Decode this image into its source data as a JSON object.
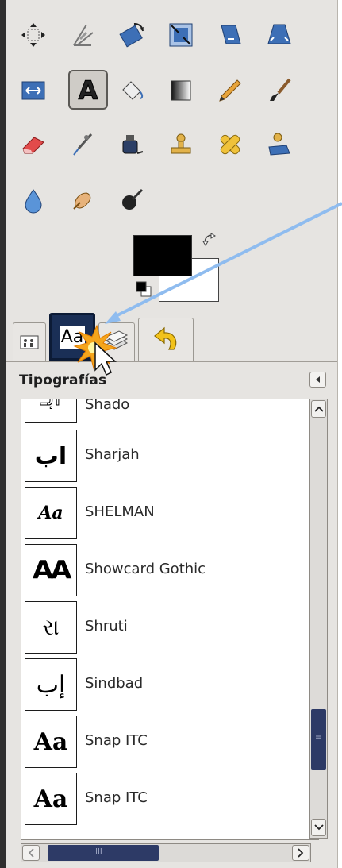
{
  "colors": {
    "panel_bg": "#e6e4e1",
    "selected_tab": "#1a2f56",
    "scroll_thumb": "#2d3a66",
    "annotation_arrow": "#8fbcef",
    "foreground_color": "#000000",
    "background_color": "#ffffff"
  },
  "toolbox": {
    "tools": [
      {
        "name": "move-tool-icon"
      },
      {
        "name": "crop-tool-icon"
      },
      {
        "name": "rotate-tool-icon"
      },
      {
        "name": "scale-tool-icon"
      },
      {
        "name": "shear-tool-icon"
      },
      {
        "name": "perspective-tool-icon"
      },
      {
        "name": "flip-tool-icon"
      },
      {
        "name": "text-tool-icon",
        "label": "A",
        "active": true
      },
      {
        "name": "bucket-fill-tool-icon"
      },
      {
        "name": "blend-tool-icon"
      },
      {
        "name": "pencil-tool-icon"
      },
      {
        "name": "paintbrush-tool-icon"
      },
      {
        "name": "eraser-tool-icon"
      },
      {
        "name": "airbrush-tool-icon"
      },
      {
        "name": "ink-tool-icon"
      },
      {
        "name": "clone-tool-icon"
      },
      {
        "name": "heal-tool-icon"
      },
      {
        "name": "perspective-clone-tool-icon"
      },
      {
        "name": "blur-sharpen-tool-icon"
      },
      {
        "name": "smudge-tool-icon"
      },
      {
        "name": "dodge-burn-tool-icon"
      }
    ]
  },
  "tabs": {
    "items": [
      {
        "name": "tab-tool-options",
        "icon": "tool-options-icon"
      },
      {
        "name": "tab-fonts",
        "label": "Aa",
        "selected": true
      },
      {
        "name": "tab-layers",
        "icon": "layers-icon"
      },
      {
        "name": "tab-undo-history",
        "icon": "undo-icon"
      }
    ]
  },
  "dock": {
    "title": "Tipografías",
    "config_icon": "triangle-left-icon"
  },
  "fonts": [
    {
      "name": "Shado",
      "preview": "ابـ",
      "style": "arabic-outline"
    },
    {
      "name": "Sharjah",
      "preview": "اب",
      "style": "arabic"
    },
    {
      "name": "SHELMAN",
      "preview": "Aa",
      "style": "script-bold"
    },
    {
      "name": "Showcard Gothic",
      "preview": "AA",
      "style": "heavy"
    },
    {
      "name": "Shruti",
      "preview": "રા",
      "style": "gujarati"
    },
    {
      "name": "Sindbad",
      "preview": "إب",
      "style": "arabic-thin"
    },
    {
      "name": "Snap ITC",
      "preview": "Aa",
      "style": "snap"
    },
    {
      "name": "Snap ITC",
      "preview": "Aa",
      "style": "snap"
    }
  ],
  "hscroll": {
    "grip": "III"
  },
  "vscroll": {
    "grip": "≡"
  }
}
